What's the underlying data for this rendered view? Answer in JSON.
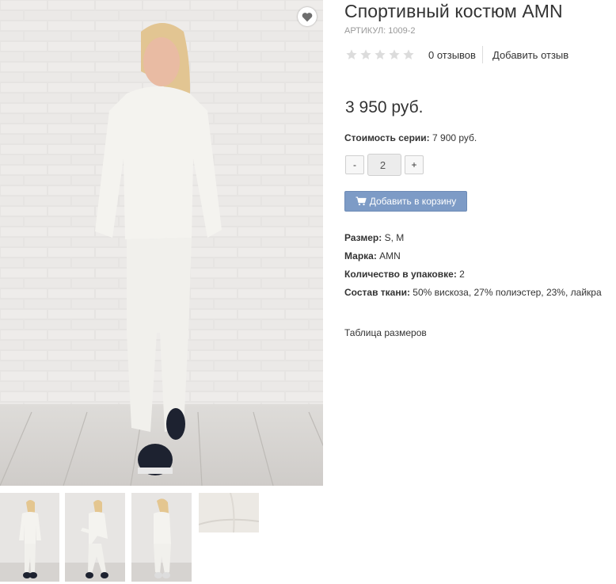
{
  "product": {
    "title": "Спортивный костюм AMN",
    "sku_label": "АРТИКУЛ:",
    "sku_value": "1009-2",
    "rating": {
      "stars_filled": 0,
      "stars_total": 5
    },
    "reviews_count": "0 отзывов",
    "add_review": "Добавить отзыв",
    "price": "3 950 руб.",
    "series_label": "Стоимость серии:",
    "series_value": "7 900 руб.",
    "quantity": {
      "minus": "-",
      "value": "2",
      "plus": "+"
    },
    "add_to_cart": "Добавить в корзину",
    "properties": [
      {
        "label": "Размер:",
        "value": "S, M"
      },
      {
        "label": "Марка:",
        "value": "AMN"
      },
      {
        "label": "Количество в упаковке:",
        "value": "2"
      },
      {
        "label": "Состав ткани:",
        "value": "50% вискоза, 27% полиэстер, 23%, лайкра"
      }
    ],
    "size_table_link": "Таблица размеров"
  },
  "icons": {
    "wishlist": "heart-icon",
    "cart": "shopping-cart-icon",
    "rating": "star-icon"
  },
  "colors": {
    "cart_button": "#7d9bc6",
    "star_empty": "#dcdcdc",
    "text": "#333333",
    "muted": "#999999"
  }
}
